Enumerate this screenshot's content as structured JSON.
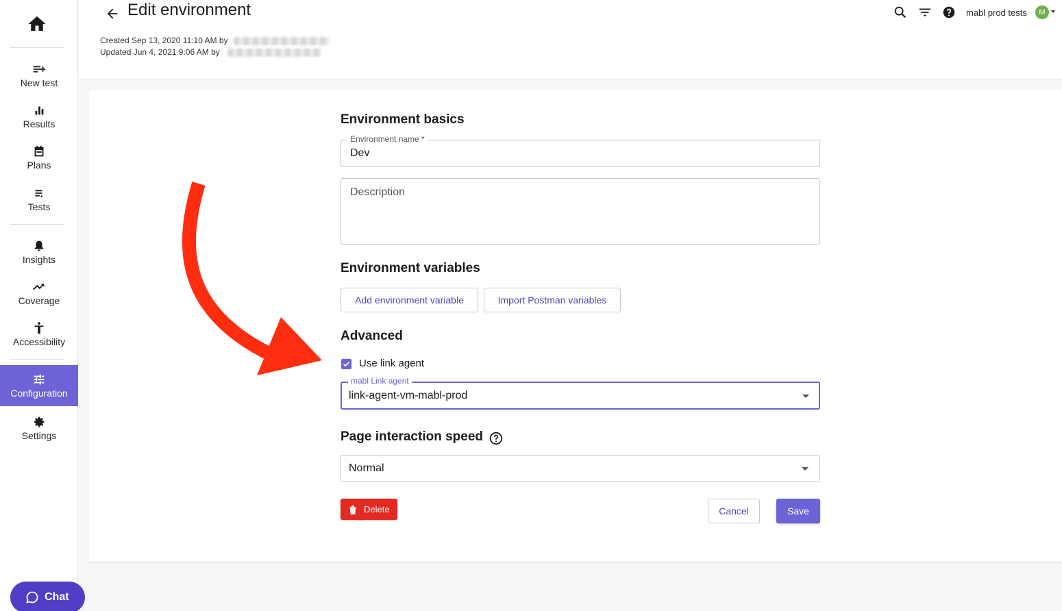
{
  "sidebar": {
    "items": [
      {
        "label": "New test",
        "icon": "new-test-icon"
      },
      {
        "label": "Results",
        "icon": "bar-chart-icon"
      },
      {
        "label": "Plans",
        "icon": "calendar-icon"
      },
      {
        "label": "Tests",
        "icon": "list-icon"
      },
      {
        "label": "Insights",
        "icon": "bell-icon"
      },
      {
        "label": "Coverage",
        "icon": "trending-up-icon"
      },
      {
        "label": "Accessibility",
        "icon": "accessibility-icon"
      },
      {
        "label": "Configuration",
        "icon": "tune-icon",
        "active": true
      },
      {
        "label": "Settings",
        "icon": "gear-icon"
      }
    ],
    "chat_label": "Chat"
  },
  "header": {
    "title": "Edit environment",
    "created": "Created Sep 13, 2020 11:10 AM by",
    "updated": "Updated Jun 4, 2021 9:06 AM by",
    "account_name": "mabl prod tests",
    "avatar_initial": "M"
  },
  "form": {
    "basics_heading": "Environment basics",
    "name_label": "Environment name *",
    "name_value": "Dev",
    "description_placeholder": "Description",
    "variables_heading": "Environment variables",
    "add_variable_label": "Add environment variable",
    "import_postman_label": "Import Postman variables",
    "advanced_heading": "Advanced",
    "use_link_agent_label": "Use link agent",
    "use_link_agent_checked": true,
    "link_agent_label": "mabl Link agent",
    "link_agent_value": "link-agent-vm-mabl-prod",
    "speed_heading": "Page interaction speed",
    "speed_value": "Normal",
    "delete_label": "Delete",
    "cancel_label": "Cancel",
    "save_label": "Save"
  },
  "colors": {
    "accent": "#6b63d6",
    "danger": "#e32a22",
    "annotation_arrow": "#ff2d0f",
    "chat": "#4f3fc7"
  }
}
